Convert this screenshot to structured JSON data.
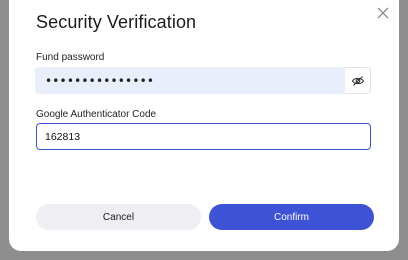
{
  "dialog": {
    "title": "Security Verification",
    "close_icon": "close-icon"
  },
  "fund_password": {
    "label": "Fund password",
    "value": "•••••••••••••••",
    "toggle_icon": "eye-off-icon"
  },
  "authenticator": {
    "label": "Google Authenticator Code",
    "value": "162813"
  },
  "actions": {
    "cancel_label": "Cancel",
    "confirm_label": "Confirm"
  },
  "colors": {
    "accent": "#3d52d5",
    "field_bg": "#e8eefa",
    "focus_border": "#3b57d8",
    "cancel_bg": "#efeff3"
  }
}
